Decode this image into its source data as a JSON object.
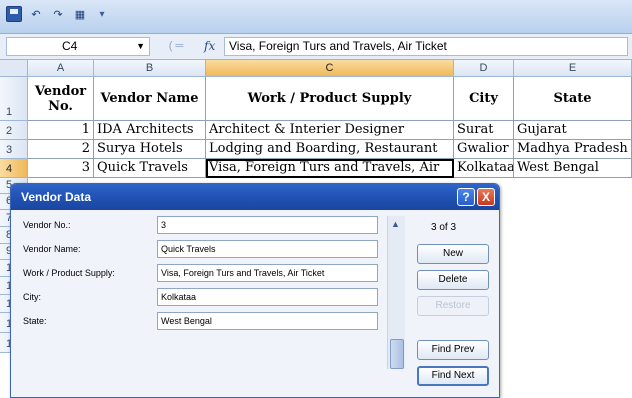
{
  "formula_bar": {
    "name_box": "C4",
    "formula": "Visa, Foreign Turs and Travels, Air Ticket"
  },
  "columns": [
    "A",
    "B",
    "C",
    "D",
    "E"
  ],
  "rows": [
    "1",
    "2",
    "3",
    "4",
    "5",
    "6",
    "7",
    "8",
    "9",
    "10",
    "11",
    "12",
    "13",
    "14"
  ],
  "table": {
    "headers": [
      "Vendor No.",
      "Vendor Name",
      "Work  / Product Supply",
      "City",
      "State"
    ],
    "records": [
      [
        "1",
        "IDA Architects",
        "Architect & Interier Designer",
        "Surat",
        "Gujarat"
      ],
      [
        "2",
        "Surya Hotels",
        "Lodging and Boarding, Restaurant",
        "Gwalior",
        "Madhya Pradesh"
      ],
      [
        "3",
        "Quick Travels",
        "Visa, Foreign Turs and Travels, Air",
        "Kolkataa",
        "West Bengal"
      ]
    ]
  },
  "dialog": {
    "title": "Vendor Data",
    "help": "?",
    "close": "X",
    "record_counter": "3 of 3",
    "fields": [
      {
        "label": "Vendor No.:",
        "value": "3"
      },
      {
        "label": "Vendor Name:",
        "value": "Quick Travels"
      },
      {
        "label": "Work  / Product Supply:",
        "value": "Visa, Foreign Turs and Travels, Air Ticket"
      },
      {
        "label": "City:",
        "value": "Kolkataa"
      },
      {
        "label": "State:",
        "value": "West Bengal"
      }
    ],
    "buttons": {
      "new": "New",
      "delete": "Delete",
      "restore": "Restore",
      "find_prev": "Find Prev",
      "find_next": "Find Next"
    }
  },
  "colors": {
    "title_bar": "#1f4fb0",
    "active_header": "#f0b85a",
    "close_button": "#c9381f"
  }
}
